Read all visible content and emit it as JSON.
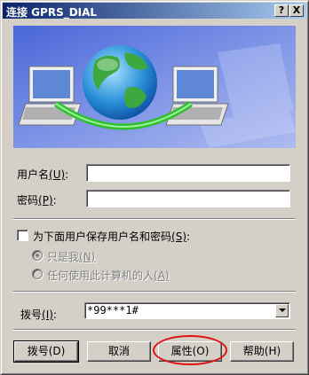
{
  "window": {
    "title": "连接 GPRS_DIAL",
    "help_button": "?",
    "close_button": "X"
  },
  "form": {
    "username_label": "用户名",
    "username_key": "(U)",
    "username_value": "",
    "password_label": "密码",
    "password_key": "(P)",
    "password_value": "",
    "save_checkbox_label": "为下面用户保存用户名和密码",
    "save_checkbox_key": "(S)",
    "save_checked": false,
    "radio_only_me": "只是我",
    "radio_only_me_key": "(N)",
    "radio_anyone": "任何使用此计算机的人",
    "radio_anyone_key": "(A)",
    "dial_label": "拨号",
    "dial_key": "(I)",
    "dial_value": "*99***1#"
  },
  "buttons": {
    "dial": "拨号(D)",
    "cancel": "取消",
    "properties": "属性(O)",
    "help": "帮助(H)"
  },
  "colors": {
    "title_start": "#0a246a",
    "title_end": "#a6caf0",
    "highlight": "#e01010"
  }
}
